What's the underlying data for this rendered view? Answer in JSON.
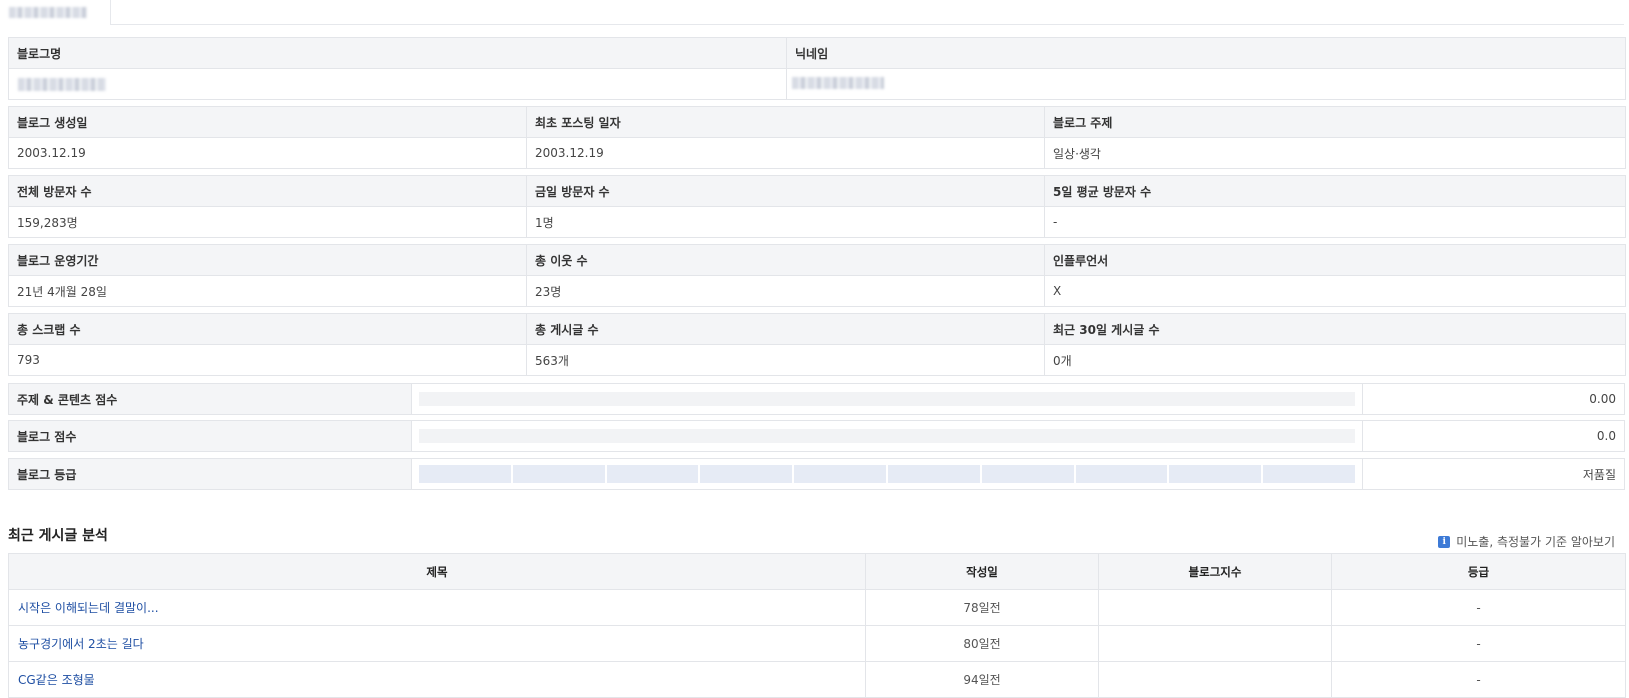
{
  "tabs": {
    "active_label": ""
  },
  "blog_info": {
    "name_label": "블로그명",
    "nickname_label": "닉네임"
  },
  "stats": [
    [
      {
        "label": "블로그 생성일",
        "value": "2003.12.19"
      },
      {
        "label": "최초 포스팅 일자",
        "value": "2003.12.19"
      },
      {
        "label": "블로그 주제",
        "value": "일상·생각"
      }
    ],
    [
      {
        "label": "전체 방문자 수",
        "value": "159,283명"
      },
      {
        "label": "금일 방문자 수",
        "value": "1명"
      },
      {
        "label": "5일 평균 방문자 수",
        "value": "-"
      }
    ],
    [
      {
        "label": "블로그 운영기간",
        "value": "21년 4개월 28일"
      },
      {
        "label": "총 이웃 수",
        "value": "23명"
      },
      {
        "label": "인플루언서",
        "value": "X"
      }
    ],
    [
      {
        "label": "총 스크랩 수",
        "value": "793"
      },
      {
        "label": "총 게시글 수",
        "value": "563개"
      },
      {
        "label": "최근 30일 게시글 수",
        "value": "0개"
      }
    ]
  ],
  "scores": {
    "topic": {
      "label": "주제 & 콘텐츠 점수",
      "value": "0.00",
      "level": 0
    },
    "blog": {
      "label": "블로그 점수",
      "value": "0.0",
      "level": 0
    },
    "grade": {
      "label": "블로그 등급",
      "value": "저품질",
      "segments": 10,
      "level": 0
    }
  },
  "recent": {
    "title": "최근 게시글 분석",
    "info_icon": "info-icon",
    "info_link": "미노출, 측정불가 기준 알아보기",
    "columns": [
      "제목",
      "작성일",
      "블로그지수",
      "등급"
    ],
    "rows": [
      {
        "title": "시작은 이해되는데 결말이...",
        "date": "78일전",
        "index": "",
        "grade": "-"
      },
      {
        "title": "농구경기에서 2초는 길다",
        "date": "80일전",
        "index": "",
        "grade": "-"
      },
      {
        "title": "CG같은 조형물",
        "date": "94일전",
        "index": "",
        "grade": "-"
      }
    ]
  }
}
